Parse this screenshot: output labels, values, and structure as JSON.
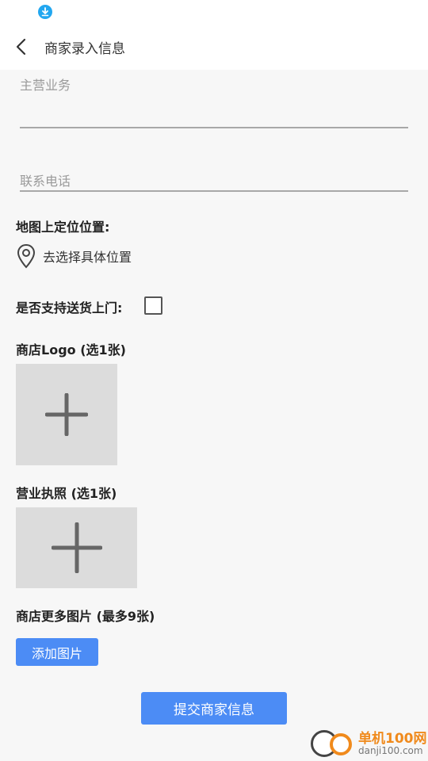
{
  "status_bar": {
    "download_icon": "download-icon"
  },
  "toolbar": {
    "back_icon": "chevron-left-icon",
    "title": "商家录入信息"
  },
  "form": {
    "main_business_placeholder": "主营业务",
    "phone_placeholder": "联系电话",
    "map_location_label": "地图上定位位置:",
    "choose_location_text": "去选择具体位置",
    "delivery_label": "是否支持送货上门:",
    "delivery_checked": false,
    "logo_label": "商店Logo (选1张)",
    "license_label": "营业执照 (选1张)",
    "more_images_label": "商店更多图片 (最多9张)",
    "add_image_button": "添加图片",
    "submit_button": "提交商家信息"
  },
  "watermark": {
    "name": "单机100网",
    "url": "danji100.com"
  },
  "colors": {
    "accent": "#4c8cf5",
    "download": "#22a7f0",
    "watermark_orange": "#f08a1c"
  }
}
